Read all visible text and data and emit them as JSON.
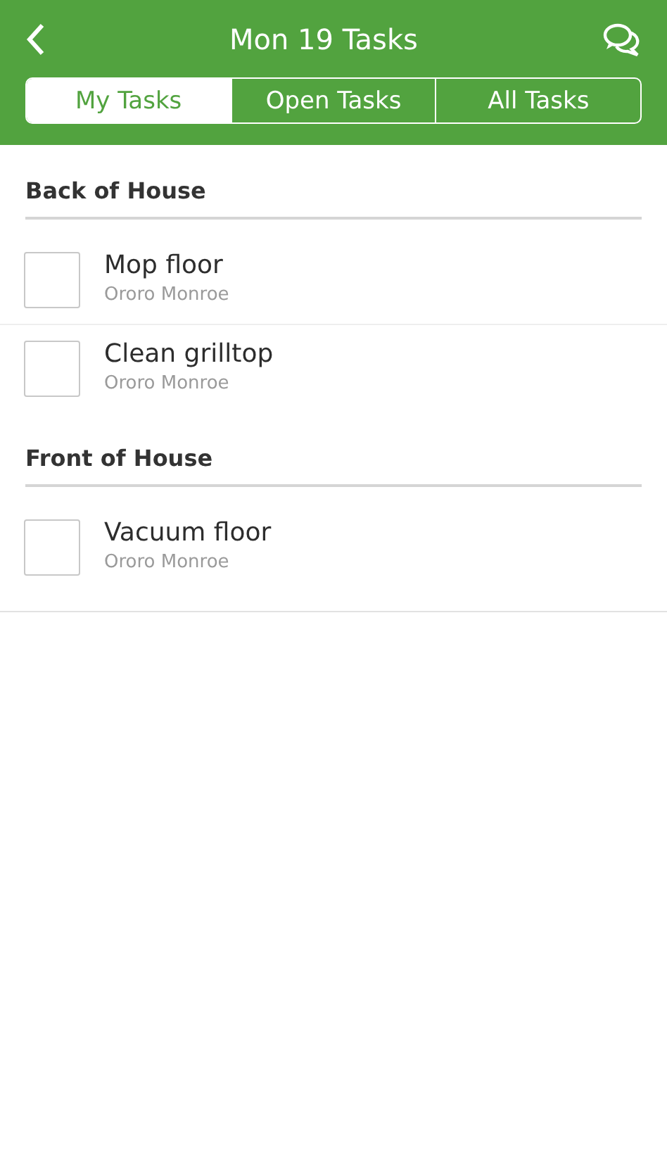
{
  "header": {
    "title": "Mon 19 Tasks"
  },
  "tabs": [
    {
      "label": "My Tasks",
      "selected": true
    },
    {
      "label": "Open Tasks",
      "selected": false
    },
    {
      "label": "All Tasks",
      "selected": false
    }
  ],
  "sections": [
    {
      "title": "Back of House",
      "tasks": [
        {
          "name": "Mop floor",
          "assignee": "Ororo Monroe",
          "checked": false
        },
        {
          "name": "Clean grilltop",
          "assignee": "Ororo Monroe",
          "checked": false
        }
      ]
    },
    {
      "title": "Front of House",
      "tasks": [
        {
          "name": "Vacuum floor",
          "assignee": "Ororo Monroe",
          "checked": false
        }
      ]
    }
  ]
}
